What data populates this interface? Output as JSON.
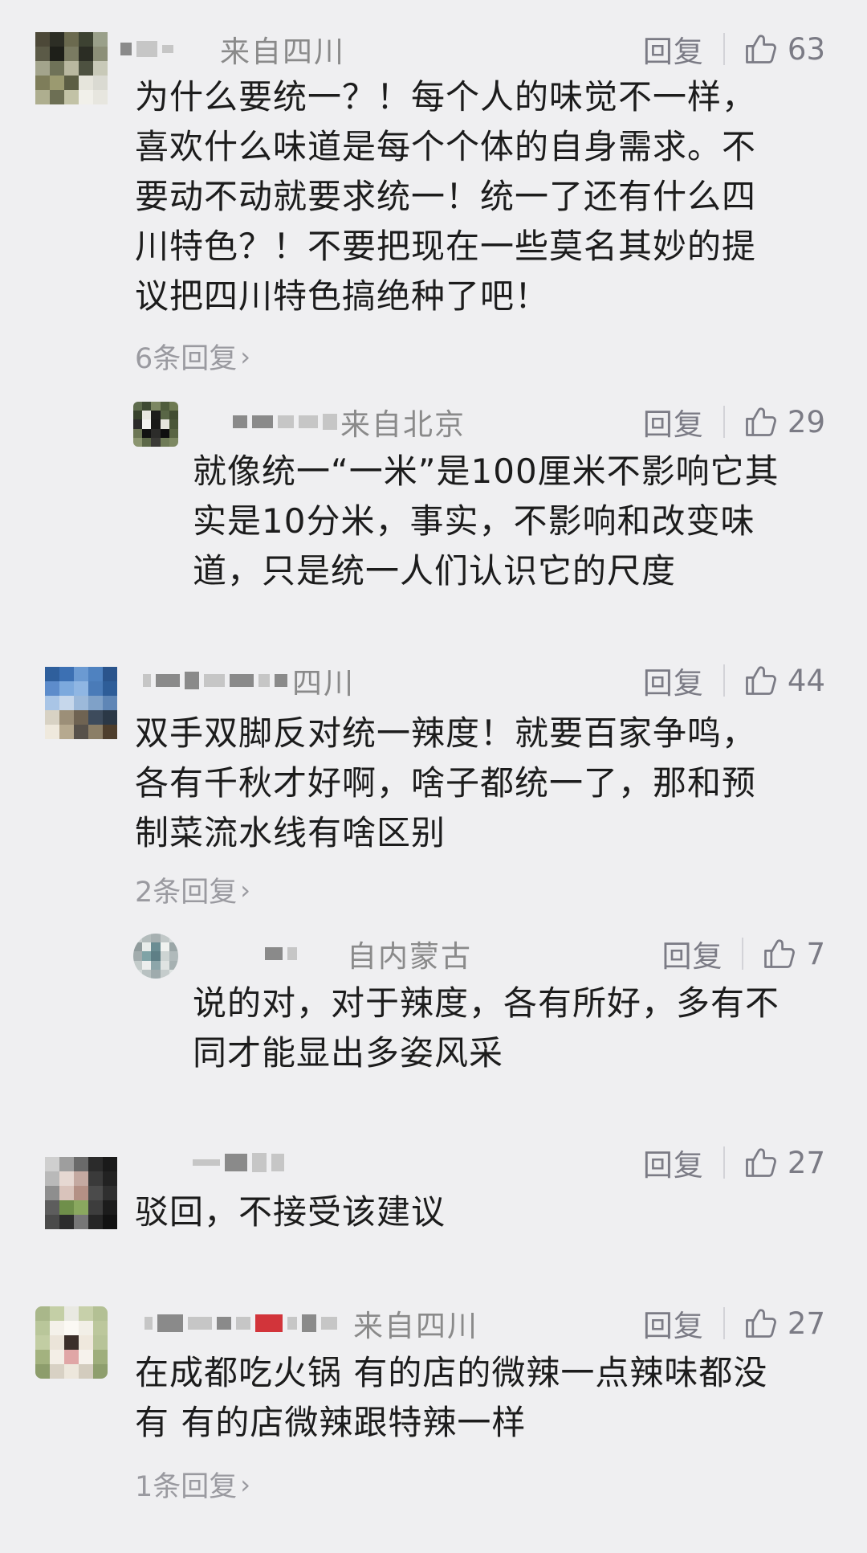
{
  "comments": [
    {
      "location": "来自四川",
      "reply_label": "回复",
      "likes": "63",
      "text": "为什么要统一？！每个人的味觉不一样，\n喜欢什么味道是每个个体的自身需求。不\n要动不动就要求统一！统一了还有什么四\n川特色？！不要把现在一些莫名其妙的提\n议把四川特色搞绝种了吧！",
      "replies_link": "6条回复",
      "sub_reply": {
        "location": "来自北京",
        "reply_label": "回复",
        "likes": "29",
        "text": "就像统一“一米”是100厘米不影响它其\n实是10分米，事实，不影响和改变味\n道，只是统一人们认识它的尺度"
      }
    },
    {
      "location": "四川",
      "reply_label": "回复",
      "likes": "44",
      "text": "双手双脚反对统一辣度！就要百家争鸣，\n各有千秋才好啊，啥子都统一了，那和预\n制菜流水线有啥区别",
      "replies_link": "2条回复",
      "sub_reply": {
        "location": "自内蒙古",
        "reply_label": "回复",
        "likes": "7",
        "text": "说的对，对于辣度，各有所好，多有不\n同才能显出多姿风采"
      }
    },
    {
      "location": "",
      "reply_label": "回复",
      "likes": "27",
      "text": "驳回，不接受该建议"
    },
    {
      "location": "来自四川",
      "reply_label": "回复",
      "likes": "27",
      "text": "在成都吃火锅 有的店的微辣一点辣味都没\n有 有的店微辣跟特辣一样",
      "replies_link": "1条回复"
    }
  ],
  "colors": {
    "background": "#efeff1",
    "meta_gray": "#8a8a8a",
    "action_gray": "#7b7b85",
    "text": "#1c1c1c"
  },
  "icons": {
    "like": "thumbs-up-icon",
    "chevron": "chevron-right-icon"
  }
}
